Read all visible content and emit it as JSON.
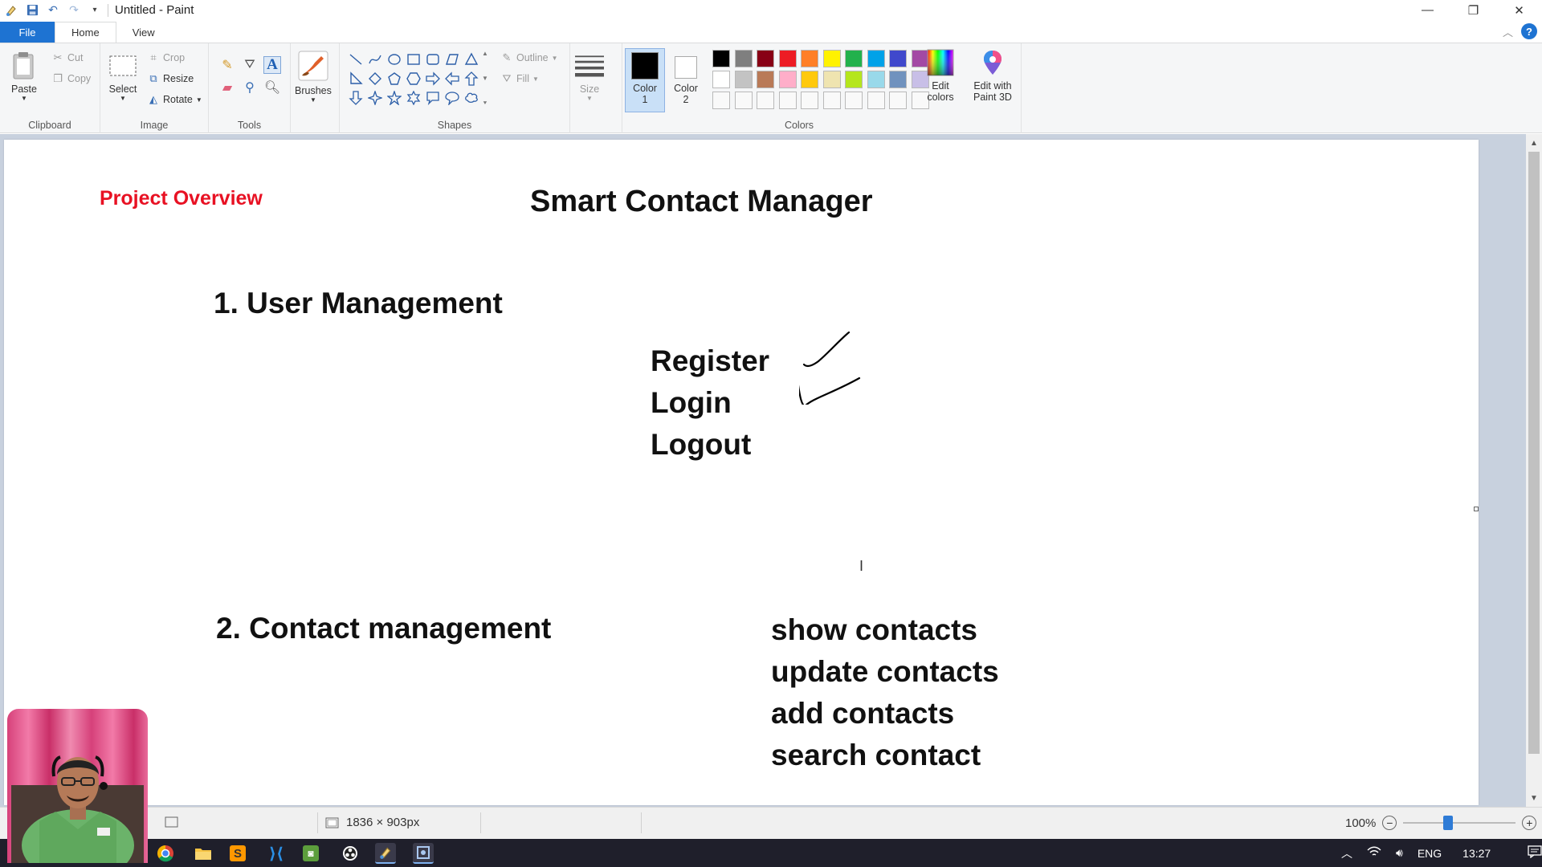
{
  "window": {
    "title": "Untitled - Paint",
    "controls": {
      "minimize": "—",
      "restore": "❐",
      "close": "✕"
    }
  },
  "tabs": {
    "file": "File",
    "home": "Home",
    "view": "View"
  },
  "ribbon": {
    "clipboard": {
      "paste": "Paste",
      "cut": "Cut",
      "copy": "Copy",
      "label": "Clipboard"
    },
    "image": {
      "select": "Select",
      "crop": "Crop",
      "resize": "Resize",
      "rotate": "Rotate",
      "label": "Image"
    },
    "tools": {
      "label": "Tools"
    },
    "brushes": {
      "label": "Brushes"
    },
    "shapes": {
      "outline": "Outline",
      "fill": "Fill",
      "label": "Shapes"
    },
    "size": {
      "label": "Size"
    },
    "colors": {
      "color1": "Color 1",
      "color1_line1": "Color",
      "color1_line2": "1",
      "color2_line1": "Color",
      "color2_line2": "2",
      "edit_colors_line1": "Edit",
      "edit_colors_line2": "colors",
      "paint3d_line1": "Edit with",
      "paint3d_line2": "Paint 3D",
      "label": "Colors",
      "color1_value": "#000000",
      "color2_value": "#ffffff",
      "palette_row1": [
        "#000000",
        "#7f7f7f",
        "#880015",
        "#ed1c24",
        "#ff7f27",
        "#fff200",
        "#22b14c",
        "#00a2e8",
        "#3f48cc",
        "#a349a4"
      ],
      "palette_row2": [
        "#ffffff",
        "#c3c3c3",
        "#b97a57",
        "#ffaec9",
        "#ffc90e",
        "#efe4b0",
        "#b5e61d",
        "#99d9ea",
        "#7092be",
        "#c8bfe7"
      ]
    }
  },
  "canvas": {
    "project_overview": "Project Overview",
    "main_title": "Smart Contact Manager",
    "section1": "1. User Management",
    "section1_items": [
      "Register",
      "Login",
      "Logout"
    ],
    "section2": "2. Contact management",
    "section2_items": [
      "show contacts",
      "update contacts",
      "add contacts",
      "search contact"
    ],
    "accent_color": "#e81123"
  },
  "statusbar": {
    "dimensions": "1836 × 903px",
    "zoom": "100%"
  },
  "taskbar": {
    "language": "ENG",
    "time": "13:27"
  }
}
